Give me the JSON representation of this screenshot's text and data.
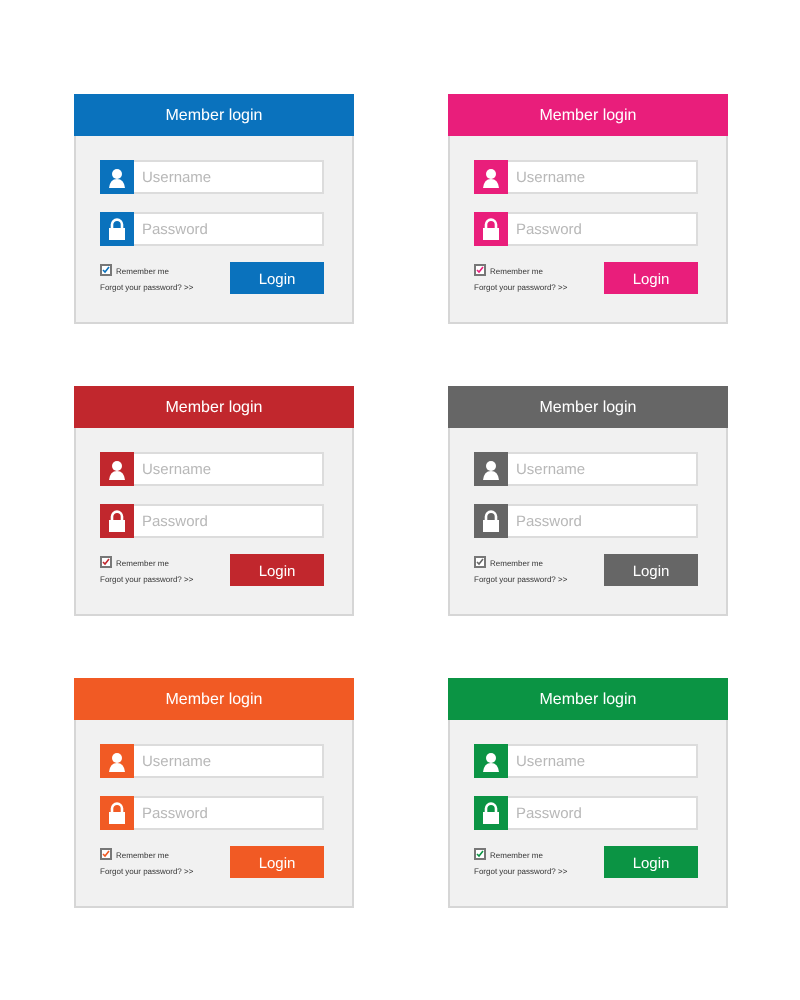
{
  "cards": [
    {
      "title": "Member login",
      "color": "#0a72bd",
      "username": {
        "placeholder": "Username"
      },
      "password": {
        "placeholder": "Password"
      },
      "remember": {
        "label": "Remember me",
        "checked": true
      },
      "forgot": "Forgot your password? >>",
      "button": "Login"
    },
    {
      "title": "Member login",
      "color": "#e91e7b",
      "username": {
        "placeholder": "Username"
      },
      "password": {
        "placeholder": "Password"
      },
      "remember": {
        "label": "Remember me",
        "checked": true
      },
      "forgot": "Forgot your password? >>",
      "button": "Login"
    },
    {
      "title": "Member login",
      "color": "#c1272d",
      "username": {
        "placeholder": "Username"
      },
      "password": {
        "placeholder": "Password"
      },
      "remember": {
        "label": "Remember me",
        "checked": true
      },
      "forgot": "Forgot your password? >>",
      "button": "Login"
    },
    {
      "title": "Member login",
      "color": "#666666",
      "username": {
        "placeholder": "Username"
      },
      "password": {
        "placeholder": "Password"
      },
      "remember": {
        "label": "Remember me",
        "checked": true
      },
      "forgot": "Forgot your password? >>",
      "button": "Login"
    },
    {
      "title": "Member login",
      "color": "#f15a24",
      "username": {
        "placeholder": "Username"
      },
      "password": {
        "placeholder": "Password"
      },
      "remember": {
        "label": "Remember me",
        "checked": true
      },
      "forgot": "Forgot your password? >>",
      "button": "Login"
    },
    {
      "title": "Member login",
      "color": "#0b9444",
      "username": {
        "placeholder": "Username"
      },
      "password": {
        "placeholder": "Password"
      },
      "remember": {
        "label": "Remember me",
        "checked": true
      },
      "forgot": "Forgot your password? >>",
      "button": "Login"
    }
  ]
}
